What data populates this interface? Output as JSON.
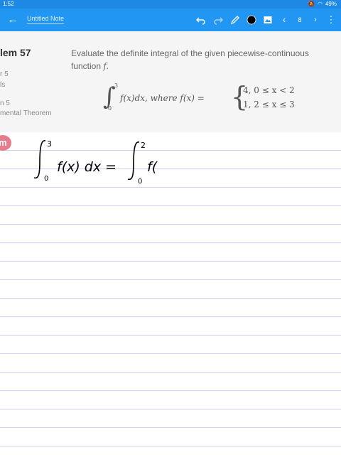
{
  "status_bar": {
    "time": "1:52",
    "battery": "49%"
  },
  "app_bar": {
    "title": "Untitled Note",
    "page_number": "8"
  },
  "lesson": {
    "problem": "lem 57",
    "line1": "r 5",
    "line2": "ls",
    "line3": "n 5",
    "line4": "mental Theorem"
  },
  "question": {
    "text_line1": "Evaluate the definite integral of the given piecewise-continuous",
    "text_line2": "function",
    "function_symbol": "f.",
    "integral_upper": "3",
    "integral_lower": "0",
    "integrand": "f(x)dx,  where f(x) =",
    "case1": "4,    0 ≤ x < 2",
    "case2": "1,    2 ≤ x ≤ 3"
  },
  "handwriting": {
    "left_upper": "3",
    "left_lower": "0",
    "left_expr": "f(x) dx =",
    "right_upper": "2",
    "right_lower": "0",
    "right_expr": "f("
  },
  "logo_letter": "m"
}
